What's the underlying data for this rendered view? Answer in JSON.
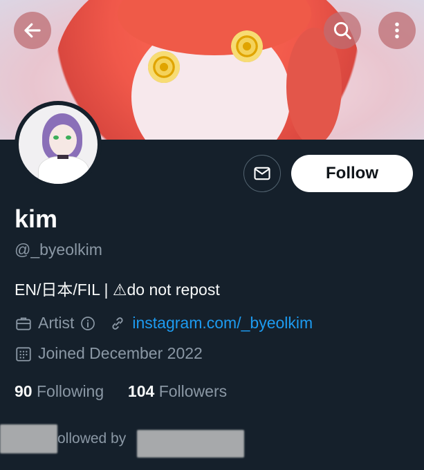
{
  "header": {
    "back_icon": "back-arrow-icon",
    "search_icon": "search-icon",
    "more_icon": "more-vertical-icon"
  },
  "profile": {
    "name": "kim",
    "handle": "@_byeolkim",
    "bio": "EN/日本/FIL | ⚠do not repost",
    "category": "Artist",
    "link": "instagram.com/_byeolkim",
    "joined": "Joined December 2022",
    "following_count": "90",
    "following_label": "Following",
    "followers_count": "104",
    "followers_label": "Followers",
    "followed_by_text": "ollowed by"
  },
  "actions": {
    "follow_label": "Follow"
  },
  "colors": {
    "background": "#15202b",
    "accent": "#1d9bf0",
    "secondary_text": "#8b98a5",
    "banner_button": "#be6e73"
  }
}
